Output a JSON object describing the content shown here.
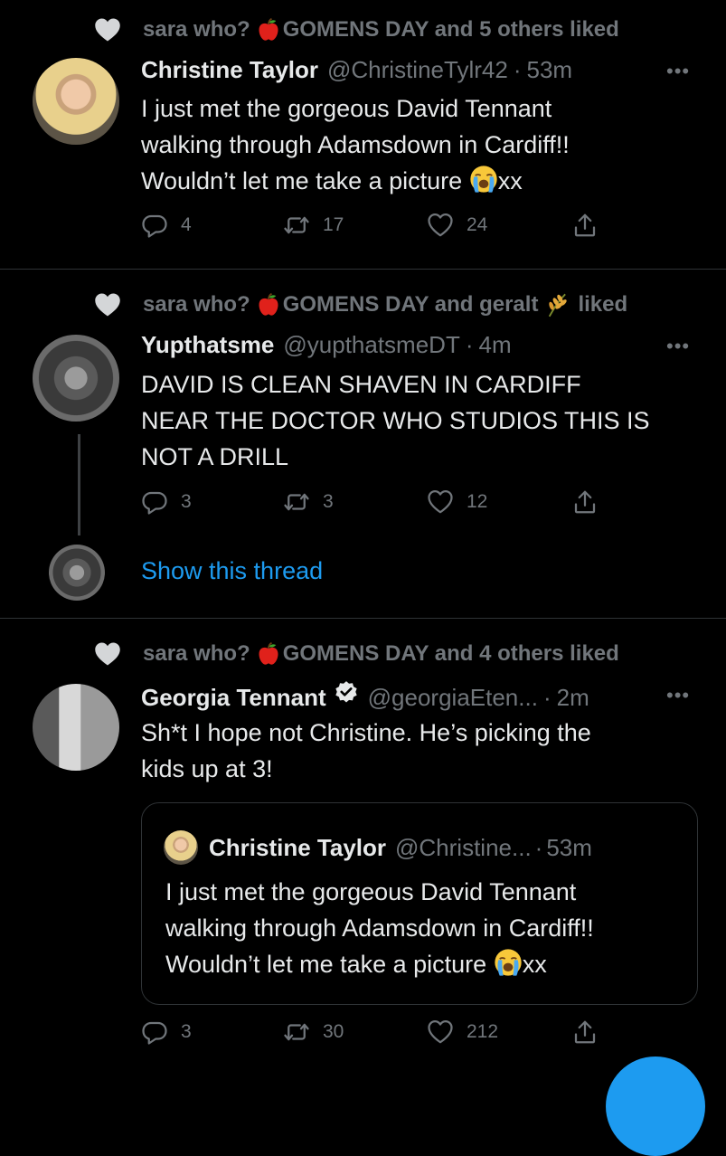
{
  "tweets": [
    {
      "social": "sara who? 🍎GOMENS DAY and 5 others liked",
      "social_a": "sara who?",
      "social_b": "GOMENS DAY and 5 others liked",
      "name": "Christine Taylor",
      "handle": "@ChristineTylr42",
      "time": "53m",
      "lines": [
        "I just met the gorgeous David Tennant",
        "walking through Adamsdown in Cardiff!!",
        "Wouldn’t let me take a picture"
      ],
      "lines_end": "xx",
      "replies": "4",
      "retweets": "17",
      "likes": "24"
    },
    {
      "social_a": "sara who?",
      "social_b": "GOMENS DAY and geralt",
      "social_c": "liked",
      "name": "Yupthatsme",
      "handle": "@yupthatsmeDT",
      "time": "4m",
      "lines": [
        "DAVID IS CLEAN SHAVEN IN CARDIFF",
        "NEAR THE DOCTOR WHO STUDIOS THIS IS",
        "NOT A DRILL"
      ],
      "replies": "3",
      "retweets": "3",
      "likes": "12",
      "show_thread": "Show this thread"
    },
    {
      "social_a": "sara who?",
      "social_b": "GOMENS DAY and 4 others liked",
      "name": "Georgia Tennant",
      "handle": "@georgiaEten...",
      "time": "2m",
      "lines": [
        "Sh*t I hope not Christine. He’s picking the",
        "kids up at 3!"
      ],
      "replies": "3",
      "retweets": "30",
      "likes": "212",
      "quote": {
        "name": "Christine Taylor",
        "handle": "@Christine...",
        "time": "53m",
        "lines": [
          "I just met the gorgeous David Tennant",
          "walking through Adamsdown in Cardiff!!",
          "Wouldn’t let me take a picture"
        ],
        "lines_end": "xx"
      }
    }
  ],
  "icons": {
    "heart": "heart-icon",
    "apple": "apple-emoji",
    "wheat": "wheat-emoji",
    "crying": "crying-emoji",
    "reply": "reply-icon",
    "retweet": "retweet-icon",
    "like": "like-icon",
    "share": "share-icon",
    "verified": "verified-icon",
    "more": "more-icon"
  },
  "more_glyph": "•••",
  "separator": "·",
  "colors": {
    "background": "#000000",
    "text": "#e7e9ea",
    "muted": "#71767b",
    "accent": "#1d9bf0",
    "divider": "#2f3336"
  }
}
